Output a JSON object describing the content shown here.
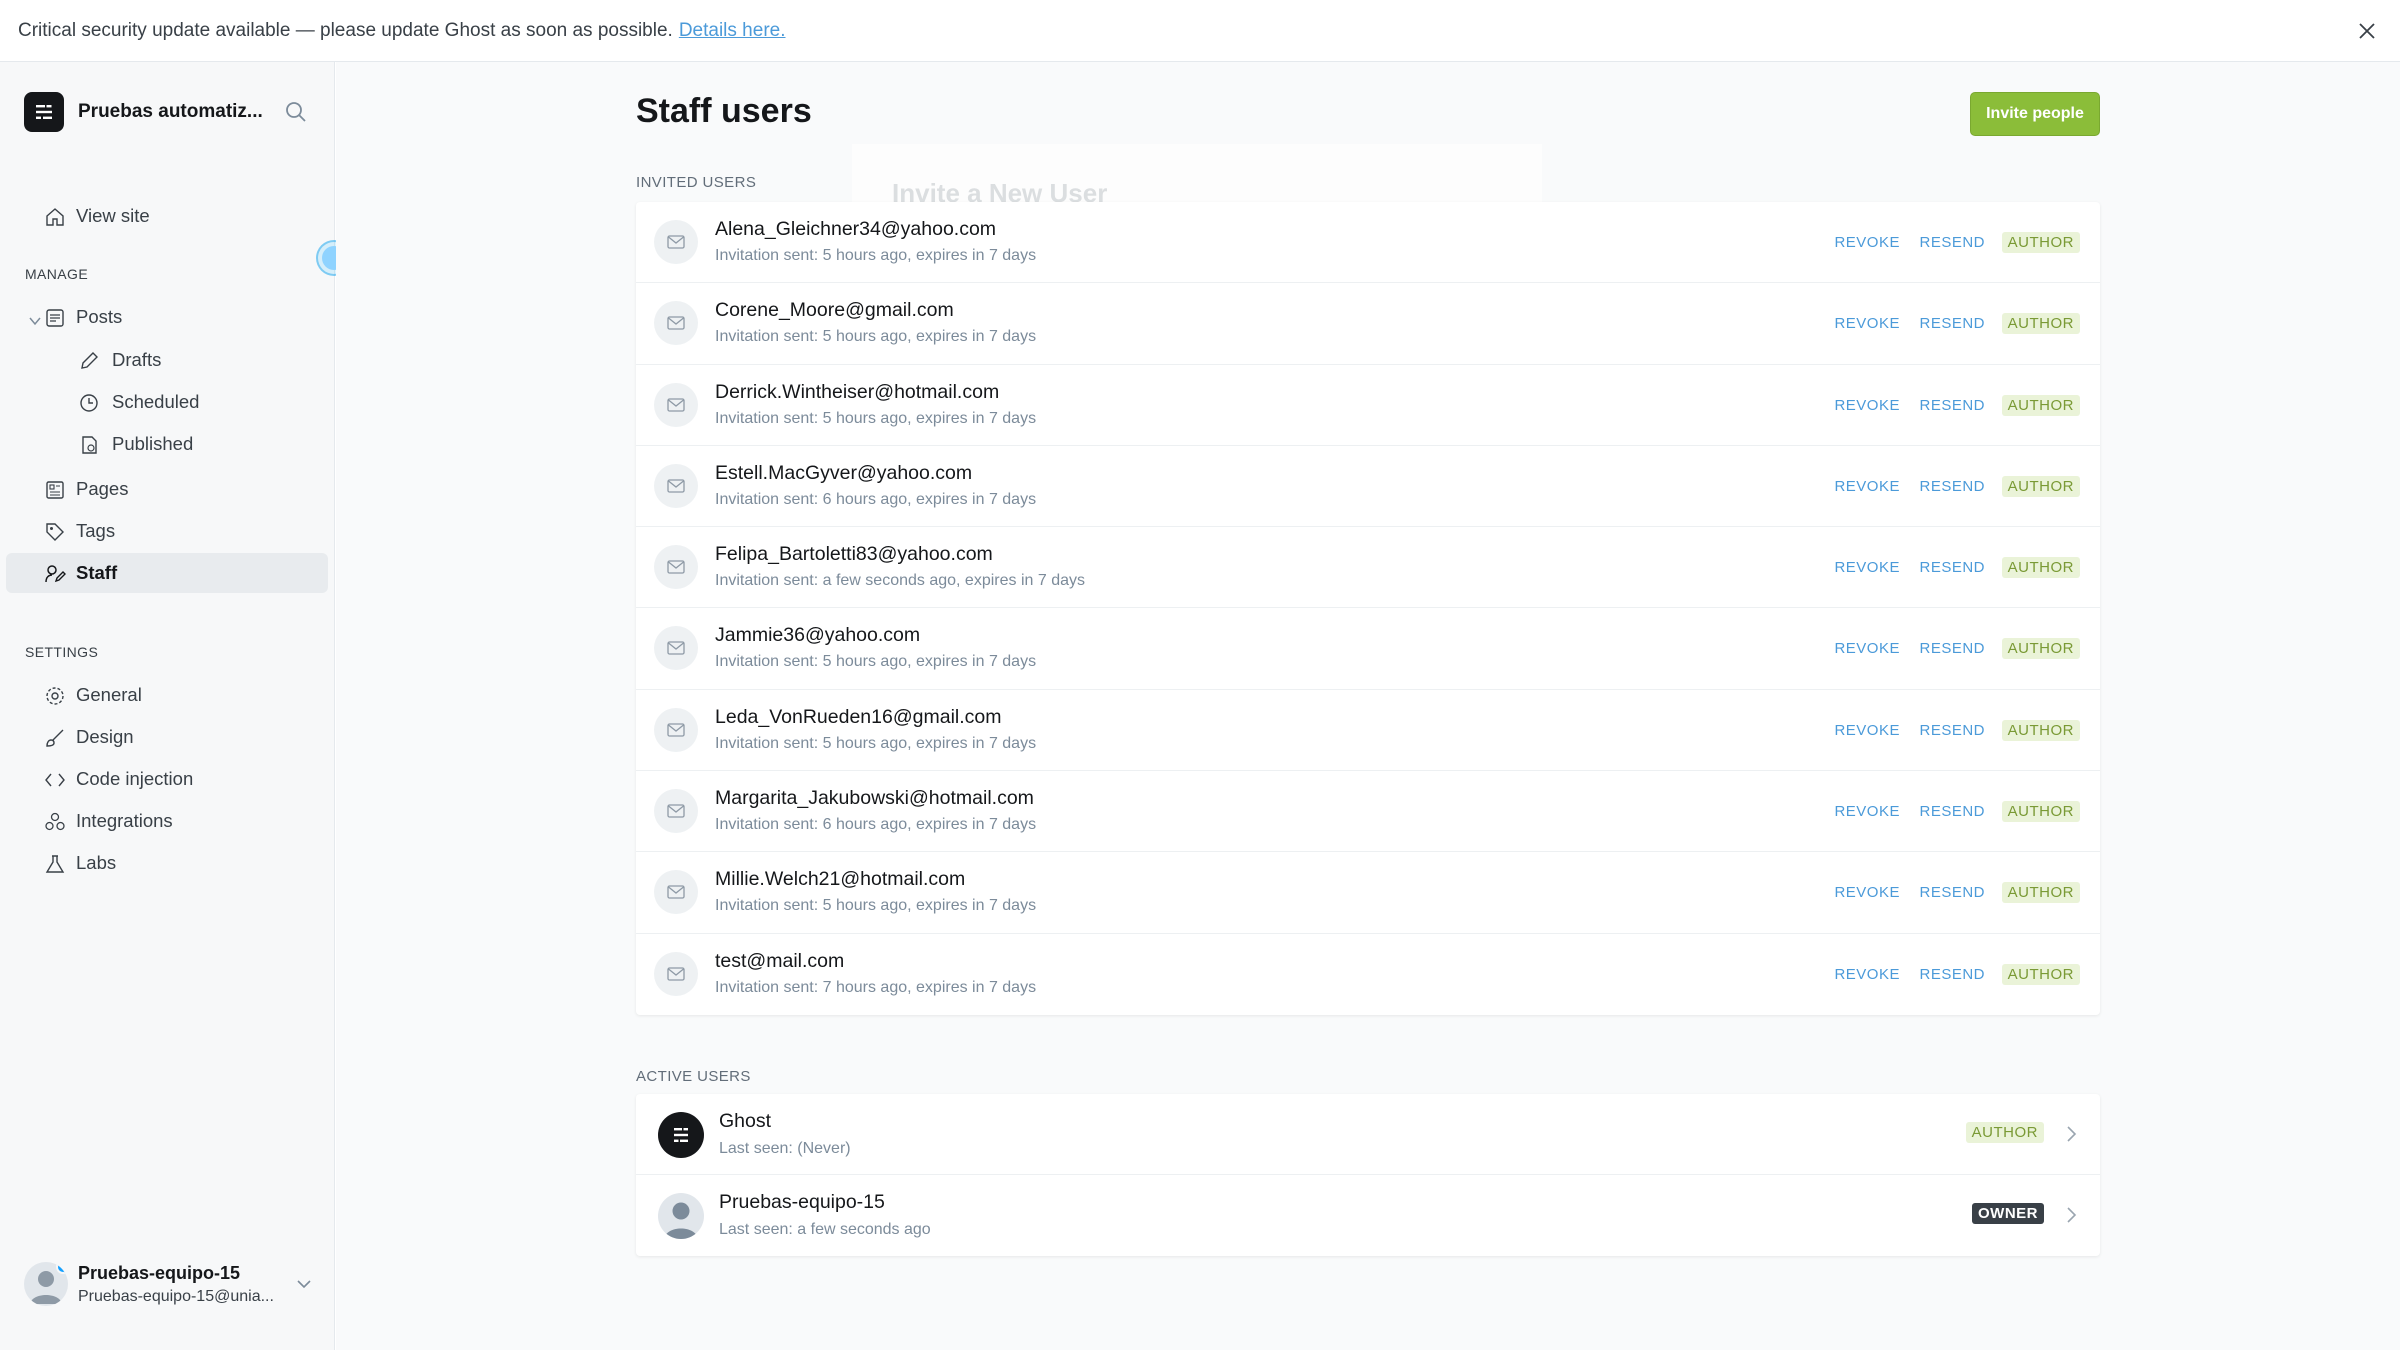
{
  "banner": {
    "text": "Critical security update available — please update Ghost as soon as possible.",
    "link": "Details here."
  },
  "sidebar": {
    "site_name": "Pruebas automatiz...",
    "view_site": "View site",
    "manage_label": "MANAGE",
    "settings_label": "SETTINGS",
    "manage_items": [
      {
        "label": "Posts"
      },
      {
        "label": "Drafts"
      },
      {
        "label": "Scheduled"
      },
      {
        "label": "Published"
      },
      {
        "label": "Pages"
      },
      {
        "label": "Tags"
      },
      {
        "label": "Staff"
      }
    ],
    "settings_items": [
      {
        "label": "General"
      },
      {
        "label": "Design"
      },
      {
        "label": "Code injection"
      },
      {
        "label": "Integrations"
      },
      {
        "label": "Labs"
      }
    ],
    "user": {
      "name": "Pruebas-equipo-15",
      "email": "Pruebas-equipo-15@unia..."
    }
  },
  "main": {
    "title": "Staff users",
    "invite_button": "Invite people",
    "modal_ghost_title": "Invite a New User",
    "invited_label": "INVITED USERS",
    "active_label": "ACTIVE USERS",
    "actions": {
      "revoke": "REVOKE",
      "resend": "RESEND"
    },
    "invited": [
      {
        "email": "Alena_Gleichner34@yahoo.com",
        "status": "Invitation sent: 5 hours ago, expires in 7 days",
        "role": "AUTHOR"
      },
      {
        "email": "Corene_Moore@gmail.com",
        "status": "Invitation sent: 5 hours ago, expires in 7 days",
        "role": "AUTHOR"
      },
      {
        "email": "Derrick.Wintheiser@hotmail.com",
        "status": "Invitation sent: 5 hours ago, expires in 7 days",
        "role": "AUTHOR"
      },
      {
        "email": "Estell.MacGyver@yahoo.com",
        "status": "Invitation sent: 6 hours ago, expires in 7 days",
        "role": "AUTHOR"
      },
      {
        "email": "Felipa_Bartoletti83@yahoo.com",
        "status": "Invitation sent: a few seconds ago, expires in 7 days",
        "role": "AUTHOR"
      },
      {
        "email": "Jammie36@yahoo.com",
        "status": "Invitation sent: 5 hours ago, expires in 7 days",
        "role": "AUTHOR"
      },
      {
        "email": "Leda_VonRueden16@gmail.com",
        "status": "Invitation sent: 5 hours ago, expires in 7 days",
        "role": "AUTHOR"
      },
      {
        "email": "Margarita_Jakubowski@hotmail.com",
        "status": "Invitation sent: 6 hours ago, expires in 7 days",
        "role": "AUTHOR"
      },
      {
        "email": "Millie.Welch21@hotmail.com",
        "status": "Invitation sent: 5 hours ago, expires in 7 days",
        "role": "AUTHOR"
      },
      {
        "email": "test@mail.com",
        "status": "Invitation sent: 7 hours ago, expires in 7 days",
        "role": "AUTHOR"
      }
    ],
    "active": [
      {
        "name": "Ghost",
        "status": "Last seen: (Never)",
        "role": "AUTHOR"
      },
      {
        "name": "Pruebas-equipo-15",
        "status": "Last seen: a few seconds ago",
        "role": "OWNER"
      }
    ]
  },
  "colors": {
    "accent_green": "#8bbd39",
    "link_blue": "#4b9ad9",
    "role_author_bg": "#eaf3d8",
    "role_owner_bg": "#394047"
  }
}
